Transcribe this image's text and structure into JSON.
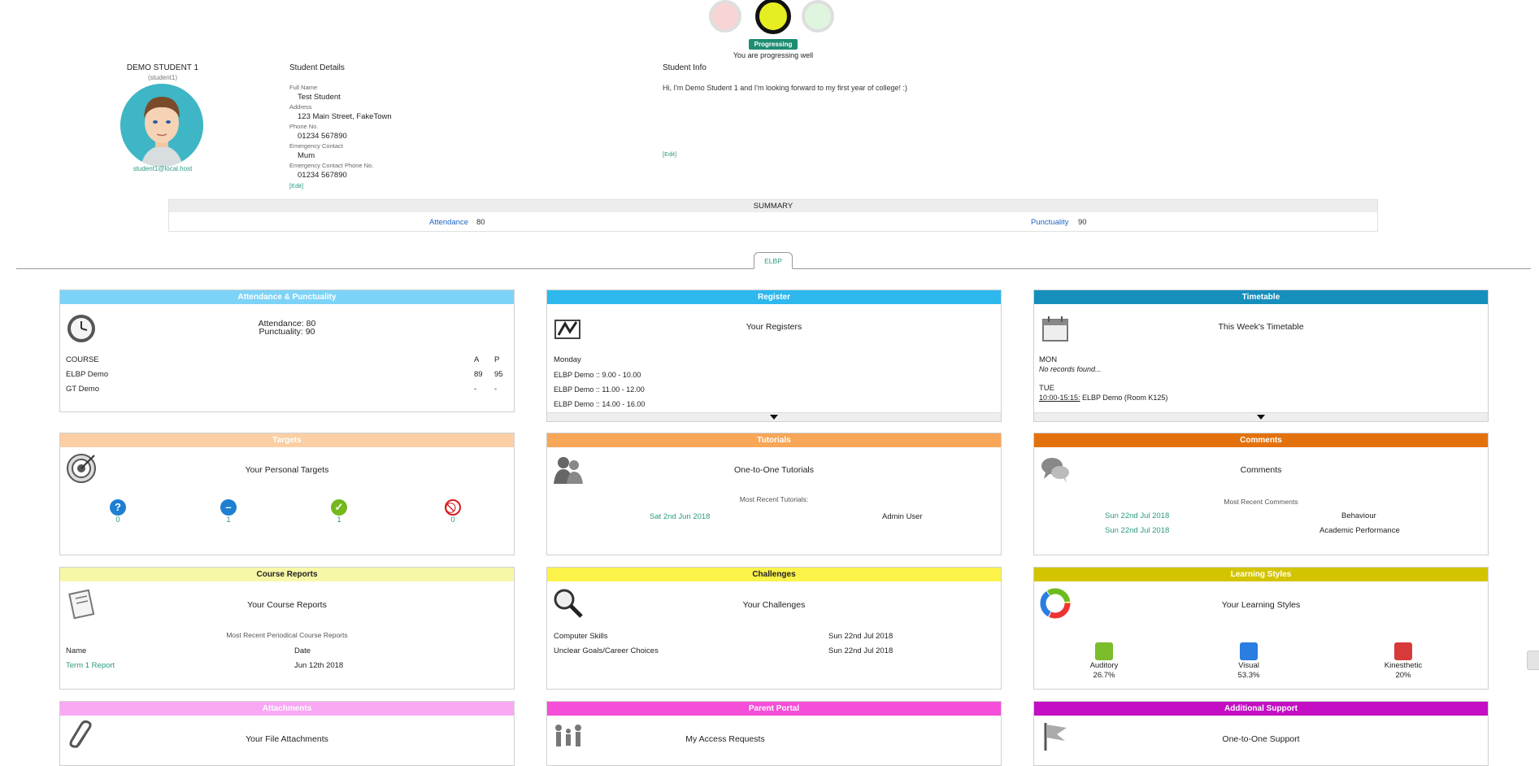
{
  "status": {
    "pill": "Progressing Well",
    "message": "You are progressing well"
  },
  "student": {
    "name": "DEMO STUDENT 1",
    "username": "(student1)",
    "email": "student1@local.host"
  },
  "details": {
    "heading": "Student Details",
    "full_name_label": "Full Name",
    "full_name": "Test Student",
    "address_label": "Address",
    "address": "123 Main Street, FakeTown",
    "phone_label": "Phone No.",
    "phone": "01234 567890",
    "emergency_label": "Emergency Contact",
    "emergency": "Mum",
    "emergency_phone_label": "Emergency Contact Phone No.",
    "emergency_phone": "01234 567890",
    "edit": "[Edit]"
  },
  "info": {
    "heading": "Student Info",
    "text": "Hi, I'm Demo Student 1 and I'm looking forward to my first year of college! :)",
    "edit": "[Edit]"
  },
  "summary": {
    "heading": "SUMMARY",
    "attendance_label": "Attendance",
    "attendance": "80",
    "punctuality_label": "Punctuality",
    "punctuality": "90"
  },
  "tab": {
    "label": "ELBP"
  },
  "panels": {
    "attendance": {
      "header": "Attendance & Punctuality",
      "color": "#7dd3f7",
      "line1": "Attendance: 80",
      "line2": "Punctuality: 90",
      "col_course": "COURSE",
      "col_a": "A",
      "col_p": "P",
      "rows": [
        {
          "course": "ELBP Demo",
          "a": "89",
          "p": "95"
        },
        {
          "course": "GT Demo",
          "a": "-",
          "p": "-"
        }
      ]
    },
    "register": {
      "header": "Register",
      "color": "#2db8ee",
      "title": "Your Registers",
      "day": "Monday",
      "items": [
        "ELBP Demo :: 9.00 - 10.00",
        "ELBP Demo :: 11.00 - 12.00",
        "ELBP Demo :: 14.00 - 16.00"
      ]
    },
    "timetable": {
      "header": "Timetable",
      "color": "#168fbd",
      "title": "This Week's Timetable",
      "day1": "MON",
      "none": "No records found...",
      "day2": "TUE",
      "time": "10:00-15:15:",
      "entry": "ELBP Demo (Room K125)"
    },
    "targets": {
      "header": "Targets",
      "color": "#fbcfa3",
      "title": "Your Personal Targets",
      "counts": [
        "0",
        "1",
        "1",
        "0"
      ]
    },
    "tutorials": {
      "header": "Tutorials",
      "color": "#f8a658",
      "title": "One-to-One Tutorials",
      "recent": "Most Recent Tutorials:",
      "date": "Sat 2nd Jun 2018",
      "by": "Admin User"
    },
    "comments": {
      "header": "Comments",
      "color": "#e3720e",
      "title": "Comments",
      "recent": "Most Recent Comments",
      "rows": [
        {
          "date": "Sun 22nd Jul 2018",
          "type": "Behaviour"
        },
        {
          "date": "Sun 22nd Jul 2018",
          "type": "Academic Performance"
        }
      ]
    },
    "reports": {
      "header": "Course Reports",
      "color": "#f7f7a8",
      "title": "Your Course Reports",
      "recent": "Most Recent Periodical Course Reports",
      "col_name": "Name",
      "col_date": "Date",
      "name": "Term 1 Report",
      "date": "Jun 12th 2018"
    },
    "challenges": {
      "header": "Challenges",
      "color": "#fbf24a",
      "title": "Your Challenges",
      "rows": [
        {
          "name": "Computer Skills",
          "date": "Sun 22nd Jul 2018"
        },
        {
          "name": "Unclear Goals/Career Choices",
          "date": "Sun 22nd Jul 2018"
        }
      ]
    },
    "styles": {
      "header": "Learning Styles",
      "color": "#d4c400",
      "title": "Your Learning Styles",
      "items": [
        {
          "label": "Auditory",
          "value": "26.7%"
        },
        {
          "label": "Visual",
          "value": "53.3%"
        },
        {
          "label": "Kinesthetic",
          "value": "20%"
        }
      ]
    },
    "attachments": {
      "header": "Attachments",
      "color": "#f9a8f4",
      "title": "Your File Attachments"
    },
    "parent": {
      "header": "Parent Portal",
      "color": "#f54ed8",
      "title": "My Access Requests"
    },
    "support": {
      "header": "Additional Support",
      "color": "#c30ec3",
      "title": "One-to-One Support"
    }
  }
}
